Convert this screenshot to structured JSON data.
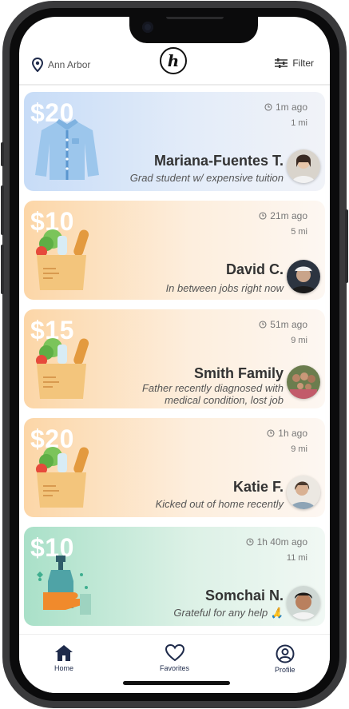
{
  "header": {
    "location": "Ann Arbor",
    "logo_letter": "h",
    "filter_label": "Filter",
    "location_icon": "map-pin-icon",
    "filter_icon": "sliders-icon"
  },
  "requests": [
    {
      "amount": "$20",
      "time": "1m ago",
      "distance": "1 mi",
      "name": "Mariana-Fuentes T.",
      "description": "Grad student w/ expensive tuition",
      "illustration": "shirt",
      "theme": "blue"
    },
    {
      "amount": "$10",
      "time": "21m ago",
      "distance": "5 mi",
      "name": "David C.",
      "description": "In between jobs right now",
      "illustration": "grocery-bag",
      "theme": "orange"
    },
    {
      "amount": "$15",
      "time": "51m ago",
      "distance": "9 mi",
      "name": "Smith Family",
      "description": "Father recently diagnosed with medical condition, lost job",
      "illustration": "grocery-bag",
      "theme": "orange"
    },
    {
      "amount": "$20",
      "time": "1h ago",
      "distance": "9 mi",
      "name": "Katie F.",
      "description": "Kicked out of home recently",
      "illustration": "grocery-bag",
      "theme": "orange"
    },
    {
      "amount": "$10",
      "time": "1h 40m ago",
      "distance": "11 mi",
      "name": "Somchai N.",
      "description": "Grateful for any help 🙏",
      "illustration": "soap-hand",
      "theme": "green"
    }
  ],
  "tabs": [
    {
      "label": "Home",
      "icon": "home-icon",
      "active": true
    },
    {
      "label": "Favorites",
      "icon": "heart-icon",
      "active": false
    },
    {
      "label": "Profile",
      "icon": "user-circle-icon",
      "active": false
    }
  ],
  "colors": {
    "blue_card": "#d6e6fb",
    "orange_card": "#fde0b9",
    "green_card": "#bfe8d6",
    "nav_active": "#1e2a4a"
  }
}
